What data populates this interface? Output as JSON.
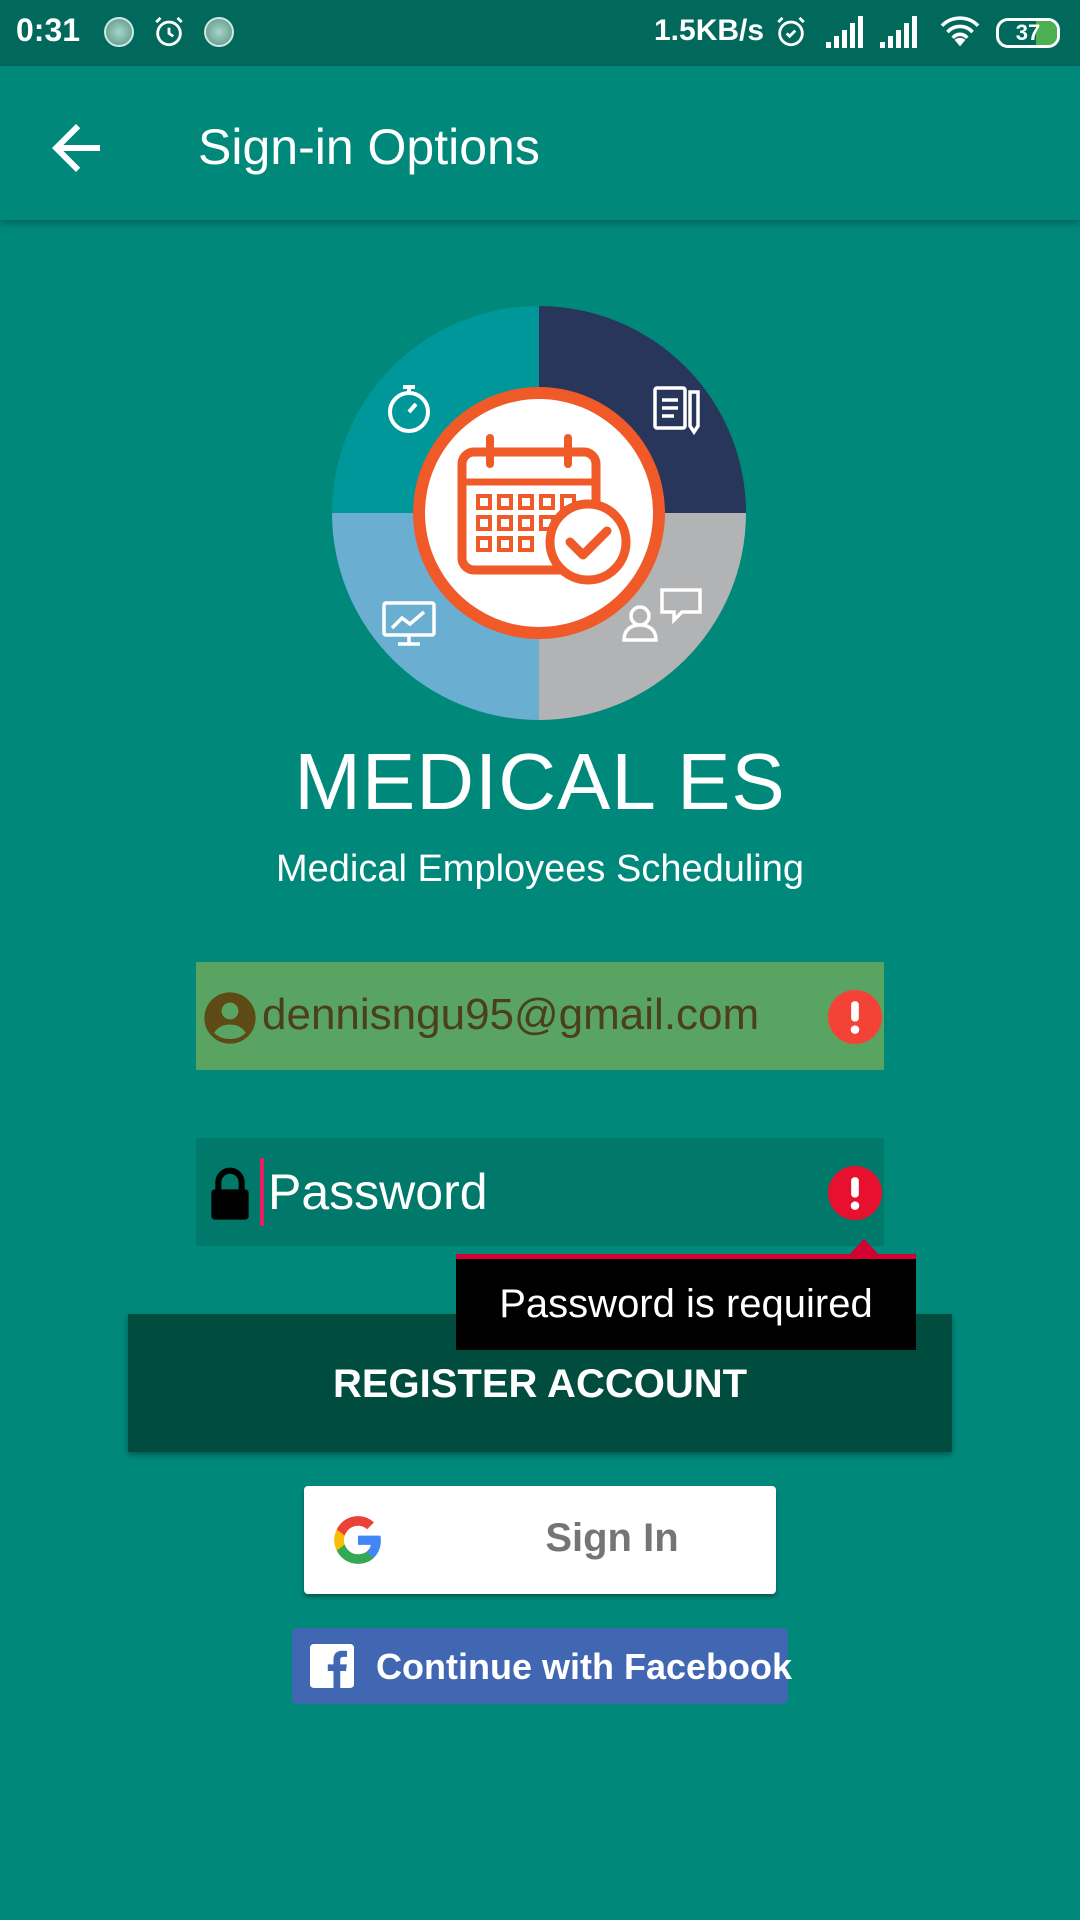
{
  "status_bar": {
    "time": "0:31",
    "network_speed": "1.5KB/s",
    "battery_level": "37",
    "icons": [
      "notification-dot-icon",
      "alarm-icon",
      "notification-dot-icon",
      "alarm-icon",
      "signal-icon",
      "signal-icon",
      "wifi-icon",
      "battery-icon"
    ]
  },
  "app_bar": {
    "title": "Sign-in Options",
    "back_icon": "arrow-back-icon"
  },
  "brand": {
    "name": "MEDICAL ES",
    "subtitle": "Medical Employees Scheduling",
    "logo_colors": [
      "#00979b",
      "#27365a",
      "#6aafd2",
      "#b2b3b5",
      "#ef5a28"
    ]
  },
  "form": {
    "email": {
      "value": "dennisngu95@gmail.com",
      "icon": "account-circle-icon",
      "error_icon": "error-icon"
    },
    "password": {
      "placeholder": "Password",
      "value": "",
      "icon": "lock-icon",
      "error_icon": "error-icon",
      "error_message": "Password is required"
    }
  },
  "buttons": {
    "register": "REGISTER ACCOUNT",
    "google_sign_in": "Sign In",
    "facebook": "Continue with Facebook"
  },
  "colors": {
    "background": "#00897b",
    "status_bar": "#00695c",
    "register_button": "#004d40",
    "email_field": "#5aa463",
    "error": "#f44336",
    "facebook": "#4267b2"
  }
}
